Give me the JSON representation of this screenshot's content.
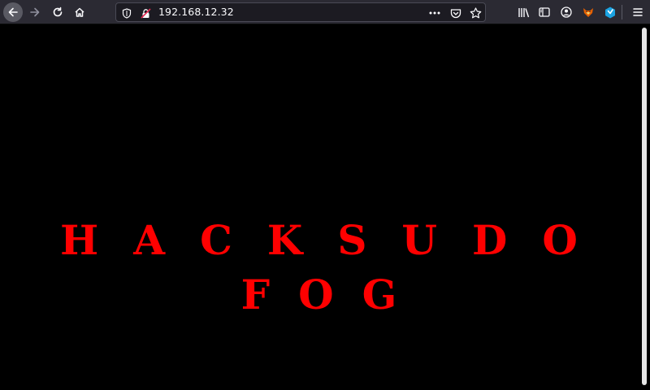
{
  "browser": {
    "url": "192.168.12.32",
    "icons": {
      "back": "back-arrow-icon",
      "forward": "forward-arrow-icon",
      "reload": "reload-icon",
      "home": "home-icon",
      "shield": "tracking-shield-icon",
      "insecure": "insecure-lock-icon",
      "more": "page-actions-icon",
      "pocket": "pocket-icon",
      "bookmark": "bookmark-star-icon",
      "library": "library-icon",
      "sidebar": "sidebar-icon",
      "account": "account-icon",
      "ext1": "extension-fox-icon",
      "ext2": "extension-cube-icon",
      "menu": "hamburger-menu-icon"
    }
  },
  "page": {
    "line1": "HACKSUDO",
    "line2": "FOG",
    "text_color": "#ff0000",
    "background_color": "#000000"
  }
}
